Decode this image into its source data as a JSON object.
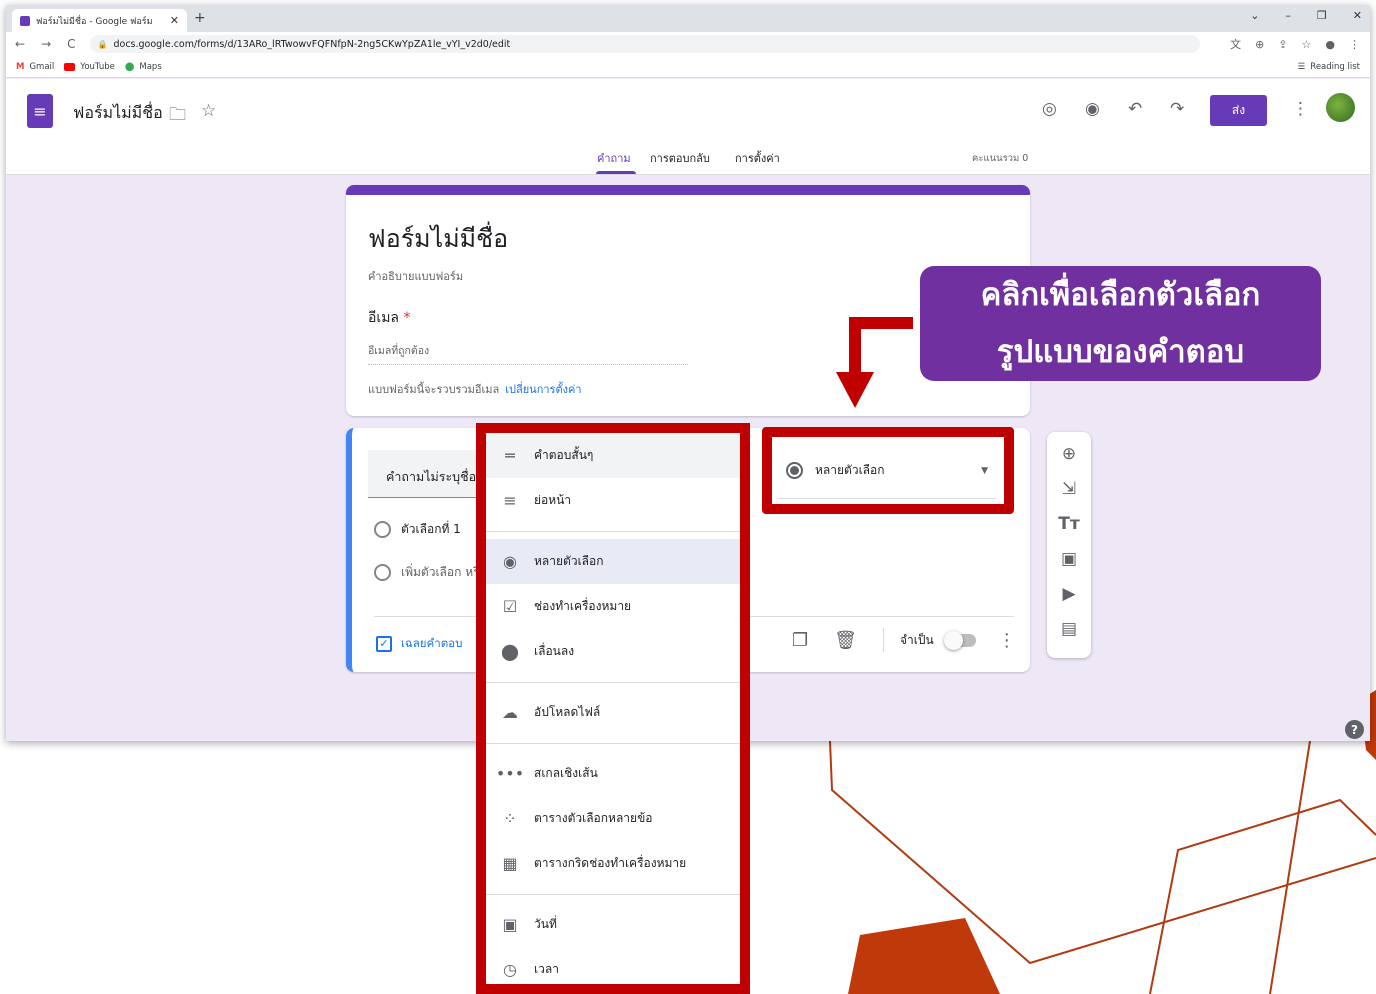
{
  "browser": {
    "tab_title": "ฟอร์มไม่มีชื่อ - Google ฟอร์ม",
    "tab_close": "✕",
    "new_tab": "+",
    "window_controls": [
      "⌄",
      "–",
      "❐",
      "✕"
    ],
    "url": "docs.google.com/forms/d/13ARo_lRTwowvFQFNfpN-2ng5CKwYpZA1le_vYI_v2d0/edit",
    "nav_icons": [
      "←",
      "→",
      "C"
    ],
    "bookmarks": [
      "Gmail",
      "YouTube",
      "Maps"
    ],
    "reading_list": "Reading list"
  },
  "app": {
    "title": "ฟอร์มไม่มีชื่อ",
    "send_label": "ส่ง",
    "tabs": [
      "คำถาม",
      "การตอบกลับ",
      "การตั้งค่า"
    ],
    "score": "คะแนนรวม 0"
  },
  "form": {
    "title": "ฟอร์มไม่มีชื่อ",
    "description": "คำอธิบายแบบฟอร์ม",
    "email_label": "อีเมล",
    "required_mark": "*",
    "email_placeholder": "อีเมลที่ถูกต้อง",
    "email_note": "แบบฟอร์มนี้จะรวบรวมอีเมล",
    "change_settings": "เปลี่ยนการตั้งค่า"
  },
  "question": {
    "title": "คำถามไม่ระบุชื่อ",
    "option1": "ตัวเลือกที่ 1",
    "add_option": "เพิ่มตัวเลือก หรือ",
    "answer_key": "เฉลยคำตอบ",
    "required": "จำเป็น",
    "type_selected": "หลายตัวเลือก"
  },
  "menu": {
    "items": [
      "คำตอบสั้นๆ",
      "ย่อหน้า",
      "หลายตัวเลือก",
      "ช่องทำเครื่องหมาย",
      "เลื่อนลง",
      "อัปโหลดไฟล์",
      "สเกลเชิงเส้น",
      "ตารางตัวเลือกหลายข้อ",
      "ตารางกริดช่องทำเครื่องหมาย",
      "วันที่",
      "เวลา"
    ]
  },
  "callout": {
    "line1": "คลิกเพื่อเลือกตัวเลือก",
    "line2": "รูปแบบของคำตอบ"
  },
  "colors": {
    "accent": "#673ab7",
    "highlight": "#c00000",
    "callout": "#7030a0",
    "decoration": "#c0390b"
  }
}
